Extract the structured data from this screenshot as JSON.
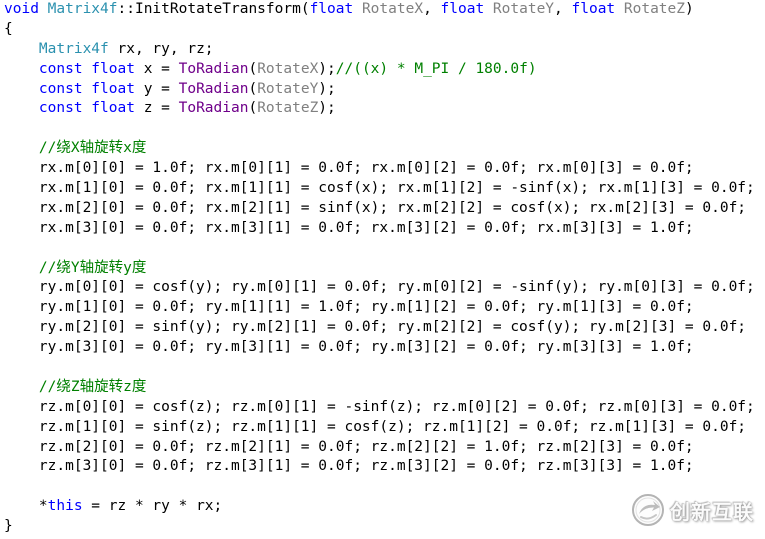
{
  "editor": {
    "background": "#FFFFFF",
    "syntax_colors": {
      "keyword": "#0000FF",
      "class": "#2B91AF",
      "param": "#808080",
      "macro": "#6F008A",
      "comment": "#008000",
      "plain": "#000000"
    },
    "lines": [
      [
        {
          "keyword": "void "
        },
        {
          "class": "Matrix4f"
        },
        {
          "plain": "::InitRotateTransform("
        },
        {
          "keyword": "float "
        },
        {
          "param": "RotateX"
        },
        {
          "plain": ", "
        },
        {
          "keyword": "float "
        },
        {
          "param": "RotateY"
        },
        {
          "plain": ", "
        },
        {
          "keyword": "float "
        },
        {
          "param": "RotateZ"
        },
        {
          "plain": ")"
        }
      ],
      [
        {
          "plain": "{"
        }
      ],
      [
        {
          "class": "    Matrix4f"
        },
        {
          "plain": " rx, ry, rz;"
        }
      ],
      [
        {
          "keyword": "    const float "
        },
        {
          "plain": "x = "
        },
        {
          "macro": "ToRadian"
        },
        {
          "plain": "("
        },
        {
          "param": "RotateX"
        },
        {
          "plain": ");"
        },
        {
          "comment": "//((x) * M_PI / 180.0f)"
        }
      ],
      [
        {
          "keyword": "    const float "
        },
        {
          "plain": "y = "
        },
        {
          "macro": "ToRadian"
        },
        {
          "plain": "("
        },
        {
          "param": "RotateY"
        },
        {
          "plain": ");"
        }
      ],
      [
        {
          "keyword": "    const float "
        },
        {
          "plain": "z = "
        },
        {
          "macro": "ToRadian"
        },
        {
          "plain": "("
        },
        {
          "param": "RotateZ"
        },
        {
          "plain": ");"
        }
      ],
      [],
      [
        {
          "comment": "    //绕X轴旋转x度"
        }
      ],
      [
        {
          "plain": "    rx.m[0][0] = 1.0f; rx.m[0][1] = 0.0f; rx.m[0][2] = 0.0f; rx.m[0][3] = 0.0f;"
        }
      ],
      [
        {
          "plain": "    rx.m[1][0] = 0.0f; rx.m[1][1] = cosf(x); rx.m[1][2] = -sinf(x); rx.m[1][3] = 0.0f;"
        }
      ],
      [
        {
          "plain": "    rx.m[2][0] = 0.0f; rx.m[2][1] = sinf(x); rx.m[2][2] = cosf(x); rx.m[2][3] = 0.0f;"
        }
      ],
      [
        {
          "plain": "    rx.m[3][0] = 0.0f; rx.m[3][1] = 0.0f; rx.m[3][2] = 0.0f; rx.m[3][3] = 1.0f;"
        }
      ],
      [],
      [
        {
          "comment": "    //绕Y轴旋转y度"
        }
      ],
      [
        {
          "plain": "    ry.m[0][0] = cosf(y); ry.m[0][1] = 0.0f; ry.m[0][2] = -sinf(y); ry.m[0][3] = 0.0f;"
        }
      ],
      [
        {
          "plain": "    ry.m[1][0] = 0.0f; ry.m[1][1] = 1.0f; ry.m[1][2] = 0.0f; ry.m[1][3] = 0.0f;"
        }
      ],
      [
        {
          "plain": "    ry.m[2][0] = sinf(y); ry.m[2][1] = 0.0f; ry.m[2][2] = cosf(y); ry.m[2][3] = 0.0f;"
        }
      ],
      [
        {
          "plain": "    ry.m[3][0] = 0.0f; ry.m[3][1] = 0.0f; ry.m[3][2] = 0.0f; ry.m[3][3] = 1.0f;"
        }
      ],
      [],
      [
        {
          "comment": "    //绕Z轴旋转z度"
        }
      ],
      [
        {
          "plain": "    rz.m[0][0] = cosf(z); rz.m[0][1] = -sinf(z); rz.m[0][2] = 0.0f; rz.m[0][3] = 0.0f;"
        }
      ],
      [
        {
          "plain": "    rz.m[1][0] = sinf(z); rz.m[1][1] = cosf(z); rz.m[1][2] = 0.0f; rz.m[1][3] = 0.0f;"
        }
      ],
      [
        {
          "plain": "    rz.m[2][0] = 0.0f; rz.m[2][1] = 0.0f; rz.m[2][2] = 1.0f; rz.m[2][3] = 0.0f;"
        }
      ],
      [
        {
          "plain": "    rz.m[3][0] = 0.0f; rz.m[3][1] = 0.0f; rz.m[3][2] = 0.0f; rz.m[3][3] = 1.0f;"
        }
      ],
      [],
      [
        {
          "plain": "    *"
        },
        {
          "keyword": "this"
        },
        {
          "plain": " = rz * ry * rx;"
        }
      ],
      [
        {
          "plain": "}"
        }
      ]
    ]
  },
  "watermark": {
    "icon": "brand-logo-icon",
    "text": "创新互联"
  }
}
